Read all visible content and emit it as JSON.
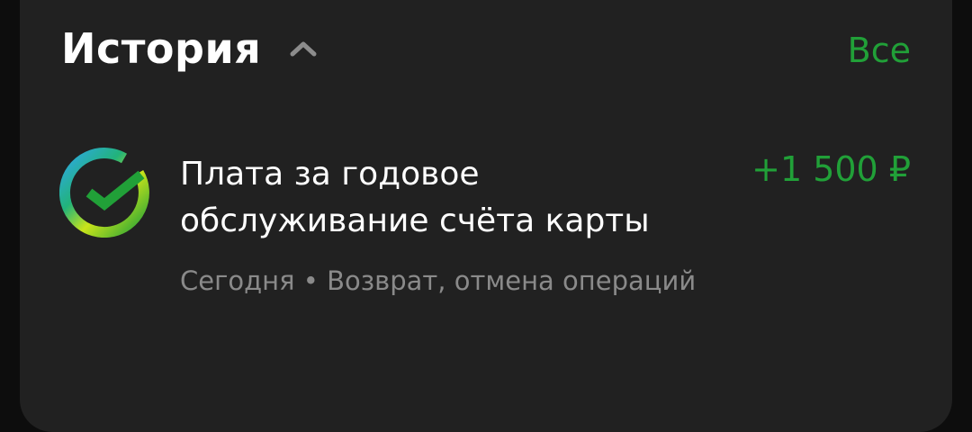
{
  "history": {
    "title": "История",
    "collapse_icon": "chevron-up-icon",
    "all_label": "Все"
  },
  "operation": {
    "logo_icon": "sberbank-logo-icon",
    "title": "Плата за годовое\nобслуживание счёта карты",
    "date": "Сегодня",
    "separator": "•",
    "category": "Возврат, отмена операций",
    "amount": "+1 500 ₽"
  },
  "colors": {
    "accent_green": "#21a038",
    "card_background": "#212121",
    "secondary_text": "#8a8a8a"
  }
}
